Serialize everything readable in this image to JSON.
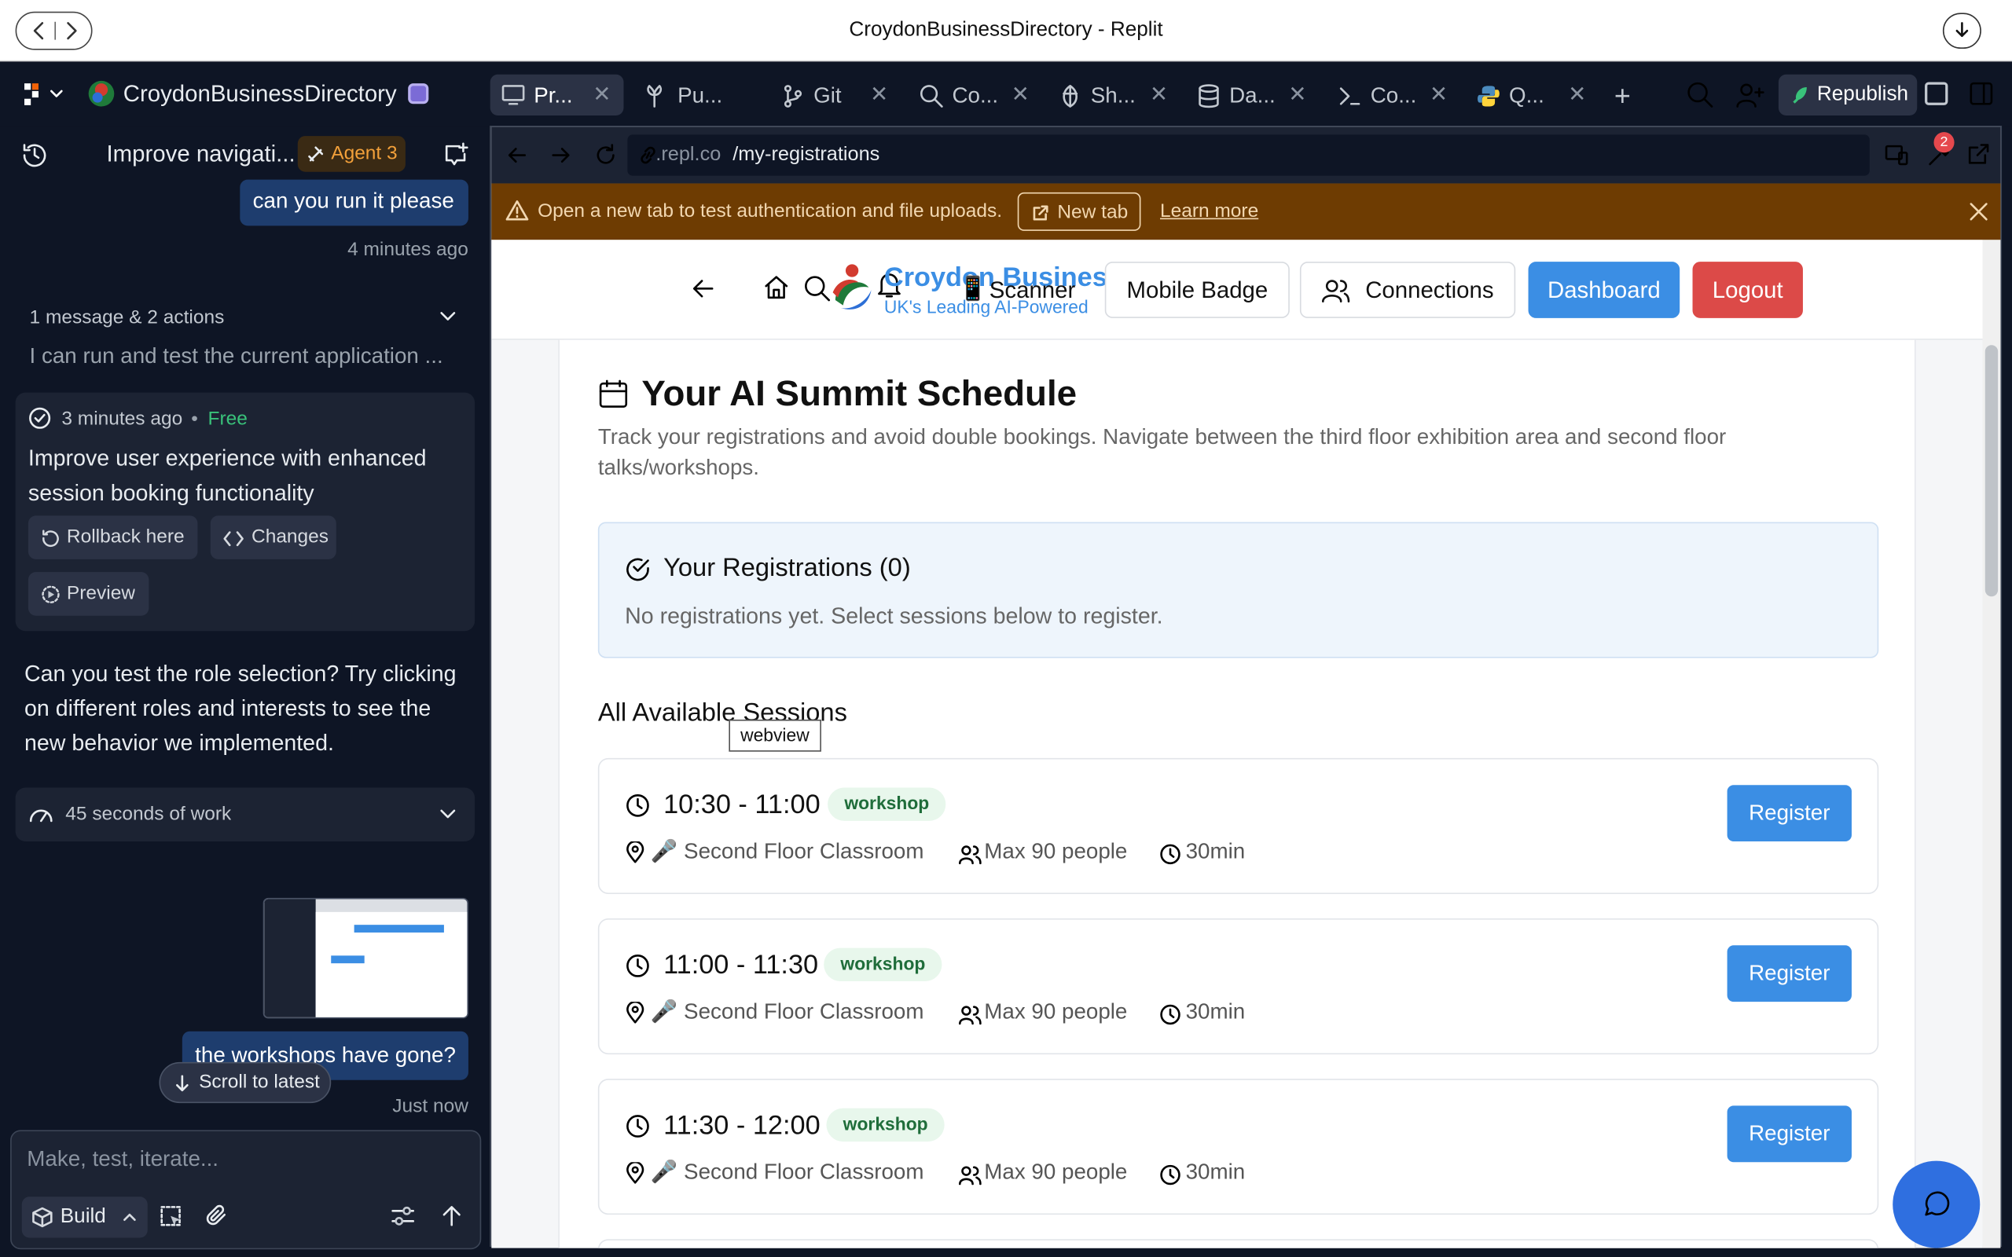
{
  "window": {
    "title": "CroydonBusinessDirectory - Replit"
  },
  "topbar": {
    "project_name": "CroydonBusinessDirectory",
    "tabs": [
      {
        "label": "Pr...",
        "icon": "monitor-icon"
      },
      {
        "label": "Pu...",
        "icon": "tree-icon"
      },
      {
        "label": "Git",
        "icon": "git-icon"
      },
      {
        "label": "Co...",
        "icon": "search-icon"
      },
      {
        "label": "Sh...",
        "icon": "shell-icon"
      },
      {
        "label": "Da...",
        "icon": "database-icon"
      },
      {
        "label": "Co...",
        "icon": "console-icon"
      },
      {
        "label": "Q...",
        "icon": "python-icon"
      }
    ],
    "republish_label": "Republish"
  },
  "chat": {
    "header_title": "Improve navigati...",
    "agent_badge": "Agent 3",
    "msg_user_1": "can you run it please",
    "msg_user_1_time": "4 minutes ago",
    "collapsed_summary": "1 message & 2 actions",
    "collapsed_preview": "I can run and test the current application ...",
    "checkpoint_time": "3 minutes ago",
    "checkpoint_price": "Free",
    "checkpoint_title": "Improve user experience with enhanced session booking functionality",
    "rollback_label": "Rollback here",
    "changes_label": "Changes",
    "preview_label": "Preview",
    "agent_message": "Can you test the role selection? Try clicking on different roles and interests to see the new behavior we implemented.",
    "work_summary": "45 seconds of work",
    "msg_user_2": "the workshops have gone?",
    "msg_user_2_time": "Just now",
    "scroll_latest": "Scroll to latest",
    "input_placeholder": "Make, test, iterate...",
    "build_label": "Build"
  },
  "browser": {
    "url_host": ".repl.co",
    "url_path": "/my-registrations",
    "notification_count": "2",
    "warning_text": "Open a new tab to test authentication and file uploads.",
    "new_tab_label": "New tab",
    "learn_more_label": "Learn more"
  },
  "app": {
    "brand_name": "Croydon Busines",
    "brand_tagline": "UK's Leading AI-Powered",
    "scanner_label": "Scanner",
    "mobile_badge_label": "Mobile Badge",
    "connections_label": "Connections",
    "dashboard_label": "Dashboard",
    "logout_label": "Logout",
    "page_title": "Your AI Summit Schedule",
    "page_desc": "Track your registrations and avoid double bookings. Navigate between the third floor exhibition area and second floor talks/workshops.",
    "registrations_title": "Your Registrations (0)",
    "registrations_empty": "No registrations yet. Select sessions below to register.",
    "sessions_heading": "All Available Sessions",
    "tooltip": "webview",
    "sessions": [
      {
        "time": "10:30 - 11:00",
        "tag": "workshop",
        "location": "🎤 Second Floor Classroom",
        "capacity": "Max 90 people",
        "duration": "30min",
        "button": "Register"
      },
      {
        "time": "11:00 - 11:30",
        "tag": "workshop",
        "location": "🎤 Second Floor Classroom",
        "capacity": "Max 90 people",
        "duration": "30min",
        "button": "Register"
      },
      {
        "time": "11:30 - 12:00",
        "tag": "workshop",
        "location": "🎤 Second Floor Classroom",
        "capacity": "Max 90 people",
        "duration": "30min",
        "button": "Register"
      }
    ]
  },
  "colors": {
    "accent": "#3b8ee4",
    "logout": "#dc4a48",
    "warning_bg": "#6e3c02",
    "ide_bg": "#0e1525",
    "user_bubble": "#1e3d6e"
  }
}
